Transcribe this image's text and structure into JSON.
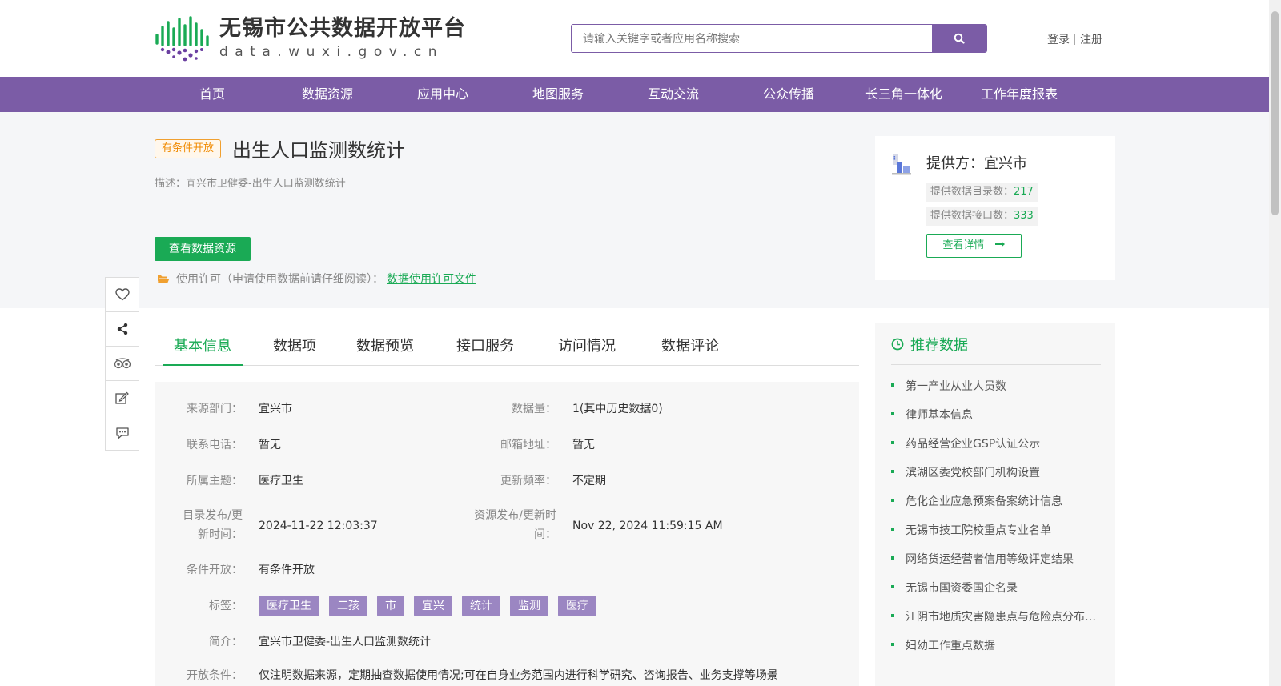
{
  "header": {
    "logo_title": "无锡市公共数据开放平台",
    "logo_sub": "data.wuxi.gov.cn",
    "search_placeholder": "请输入关键字或者应用名称搜索",
    "login": "登录",
    "register": "注册"
  },
  "nav": [
    "首页",
    "数据资源",
    "应用中心",
    "地图服务",
    "互动交流",
    "公众传播",
    "长三角一体化",
    "工作年度报表"
  ],
  "dataset": {
    "badge": "有条件开放",
    "title": "出生人口监测数统计",
    "description": "描述：宜兴市卫健委-出生人口监测数统计",
    "view_button": "查看数据资源",
    "license_text": "使用许可（申请使用数据前请仔细阅读）：",
    "license_link": "数据使用许可文件"
  },
  "provider": {
    "name": "提供方：宜兴市",
    "catalog_label": "提供数据目录数：",
    "catalog_count": "217",
    "api_label": "提供数据接口数：",
    "api_count": "333",
    "detail_button": "查看详情"
  },
  "tabs": [
    "基本信息",
    "数据项",
    "数据预览",
    "接口服务",
    "访问情况",
    "数据评论"
  ],
  "info": {
    "source_label": "来源部门：",
    "source_value": "宜兴市",
    "volume_label": "数据量：",
    "volume_value": "1(其中历史数据0)",
    "phone_label": "联系电话：",
    "phone_value": "暂无",
    "email_label": "邮箱地址：",
    "email_value": "暂无",
    "topic_label": "所属主题：",
    "topic_value": "医疗卫生",
    "freq_label": "更新频率：",
    "freq_value": "不定期",
    "catalog_time_label_1": "目录发布/更",
    "catalog_time_label_2": "新时间：",
    "catalog_time_value": "2024-11-22 12:03:37",
    "resource_time_label_1": "资源发布/更新时",
    "resource_time_label_2": "间：",
    "resource_time_value": "Nov 22, 2024 11:59:15 AM",
    "open_label": "条件开放：",
    "open_value": "有条件开放",
    "tags_label": "标签：",
    "tags": [
      "医疗卫生",
      "二孩",
      "市",
      "宜兴",
      "统计",
      "监测",
      "医疗"
    ],
    "summary_label": "简介：",
    "summary_value": "宜兴市卫健委-出生人口监测数统计",
    "condition_label": "开放条件：",
    "condition_value": "仅注明数据来源，定期抽查数据使用情况;可在自身业务范围内进行科学研究、咨询报告、业务支撑等场景"
  },
  "recommend": {
    "title": "推荐数据",
    "items": [
      "第一产业从业人员数",
      "律师基本信息",
      "药品经营企业GSP认证公示",
      "滨湖区委党校部门机构设置",
      "危化企业应急预案备案统计信息",
      "无锡市技工院校重点专业名单",
      "网络货运经营者信用等级评定结果",
      "无锡市国资委国企名录",
      "江阴市地质灾害隐患点与危险点分布信息",
      "妇幼工作重点数据"
    ]
  },
  "colors": {
    "primary": "#7b5ca6",
    "green": "#1aaa55",
    "orange": "#f08a00",
    "tag": "#9b86c2"
  }
}
